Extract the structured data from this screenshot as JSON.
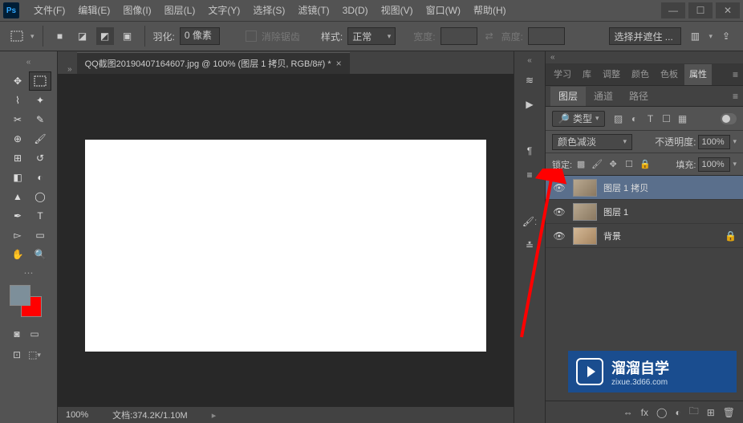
{
  "menu": {
    "items": [
      "文件(F)",
      "编辑(E)",
      "图像(I)",
      "图层(L)",
      "文字(Y)",
      "选择(S)",
      "滤镜(T)",
      "3D(D)",
      "视图(V)",
      "窗口(W)",
      "帮助(H)"
    ]
  },
  "options": {
    "feather_label": "羽化:",
    "feather_value": "0 像素",
    "antialias_label": "消除锯齿",
    "style_label": "样式:",
    "style_value": "正常",
    "width_label": "宽度:",
    "height_label": "高度:",
    "mask_btn": "选择并遮住 ..."
  },
  "document": {
    "tab_title": "QQ截图20190407164607.jpg @ 100% (图层 1 拷贝, RGB/8#) *",
    "zoom": "100%",
    "docinfo": "文档:374.2K/1.10M"
  },
  "panel_tabs": {
    "tabs": [
      "学习",
      "库",
      "调整",
      "颜色",
      "色板",
      "属性"
    ],
    "active": "属性"
  },
  "layer_panel": {
    "tabs": [
      "图层",
      "通道",
      "路径"
    ],
    "active": "图层",
    "kind_label": "类型",
    "blend_mode": "颜色减淡",
    "opacity_label": "不透明度:",
    "opacity_value": "100%",
    "lock_label": "锁定:",
    "fill_label": "填充:",
    "fill_value": "100%",
    "layers": [
      {
        "name": "图层 1 拷贝",
        "selected": true,
        "locked": false
      },
      {
        "name": "图层 1",
        "selected": false,
        "locked": false
      },
      {
        "name": "背景",
        "selected": false,
        "locked": true
      }
    ]
  },
  "brand": {
    "name": "溜溜自学",
    "sub": "zixue.3d66.com"
  },
  "colors": {
    "fg": "#7d8f9a",
    "bg": "#ff0000"
  }
}
